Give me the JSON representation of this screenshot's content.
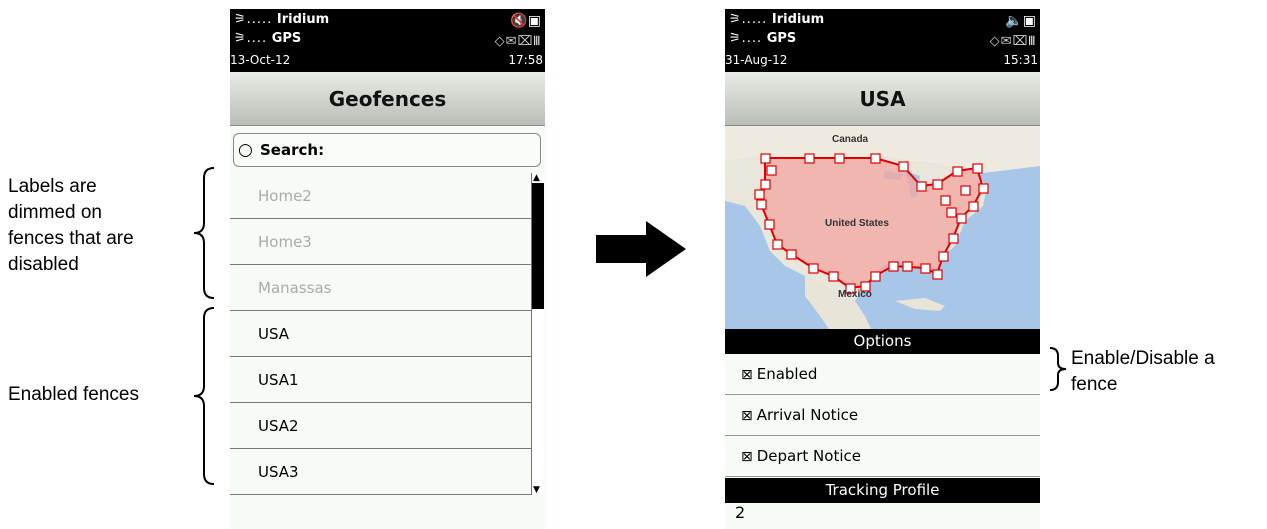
{
  "annotations": {
    "dimmed": [
      "Labels are",
      "dimmed on",
      "fences that are",
      "disabled"
    ],
    "enabled": "Enabled fences",
    "enable_disable": [
      "Enable/Disable a",
      "fence"
    ]
  },
  "left_screen": {
    "status": {
      "line1": "Iridium",
      "line2": "GPS",
      "date": "13-Oct-12",
      "time": "17:58"
    },
    "title": "Geofences",
    "search_label": "Search:",
    "fences": [
      {
        "label": "Home2",
        "enabled": false
      },
      {
        "label": "Home3",
        "enabled": false
      },
      {
        "label": "Manassas",
        "enabled": false
      },
      {
        "label": "USA",
        "enabled": true
      },
      {
        "label": "USA1",
        "enabled": true
      },
      {
        "label": "USA2",
        "enabled": true
      },
      {
        "label": "USA3",
        "enabled": true
      }
    ]
  },
  "right_screen": {
    "status": {
      "line1": "Iridium",
      "line2": "GPS",
      "date": "31-Aug-12",
      "time": "15:31"
    },
    "title": "USA",
    "map_labels": {
      "canada": "Canada",
      "us": "United States",
      "mexico": "Mexico"
    },
    "options_header": "Options",
    "options": [
      {
        "label": "Enabled",
        "checked": true
      },
      {
        "label": "Arrival Notice",
        "checked": true
      },
      {
        "label": "Depart Notice",
        "checked": true
      }
    ],
    "tracking_header": "Tracking Profile",
    "tracking_value": "2"
  },
  "colors": {
    "fence_fill": "#f2a6a0",
    "fence_stroke": "#e00000",
    "dim_text": "#aaaaaa"
  }
}
